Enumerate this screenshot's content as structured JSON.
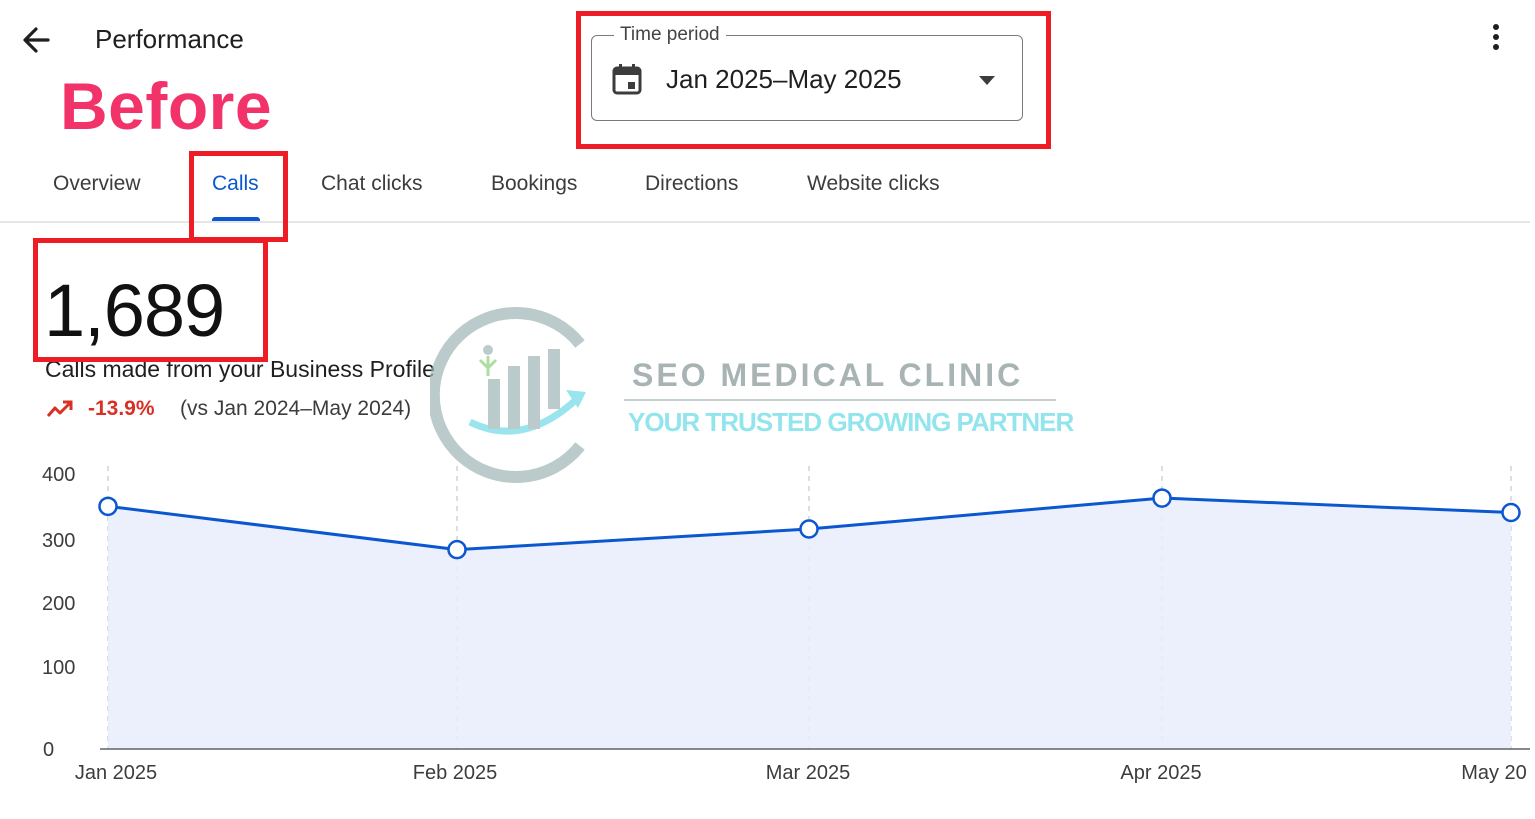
{
  "header": {
    "back_icon": "arrow-left-icon",
    "title": "Performance",
    "more_icon": "more-vert-icon"
  },
  "annotation": {
    "label": "Before",
    "highlight_color": "#ee1c25",
    "label_color": "#f2336a"
  },
  "time_period": {
    "label": "Time period",
    "value": "Jan 2025–May 2025",
    "icon": "calendar-icon",
    "dropdown_icon": "arrow-drop-down-icon"
  },
  "tabs": [
    {
      "label": "Overview",
      "active": false
    },
    {
      "label": "Calls",
      "active": true
    },
    {
      "label": "Chat clicks",
      "active": false
    },
    {
      "label": "Bookings",
      "active": false
    },
    {
      "label": "Directions",
      "active": false
    },
    {
      "label": "Website clicks",
      "active": false
    }
  ],
  "metric": {
    "value": "1,689",
    "description": "Calls made from your Business Profile",
    "trend_icon": "trending-down-icon",
    "change": "-13.9%",
    "comparison": "(vs Jan 2024–May 2024)"
  },
  "watermark": {
    "name": "SEO MEDICAL CLINIC",
    "tagline": "YOUR TRUSTED GROWING PARTNER"
  },
  "colors": {
    "accent": "#0b57d0",
    "negative": "#d93025",
    "area_fill": "#e8edfb"
  },
  "chart_data": {
    "type": "area",
    "categories": [
      "Jan 2025",
      "Feb 2025",
      "Mar 2025",
      "Apr 2025",
      "May 20"
    ],
    "values": [
      353,
      290,
      320,
      365,
      344
    ],
    "yticks": [
      "0",
      "100",
      "200",
      "300",
      "400"
    ],
    "ylim": [
      0,
      420
    ],
    "grid": "vertical-dashed"
  }
}
